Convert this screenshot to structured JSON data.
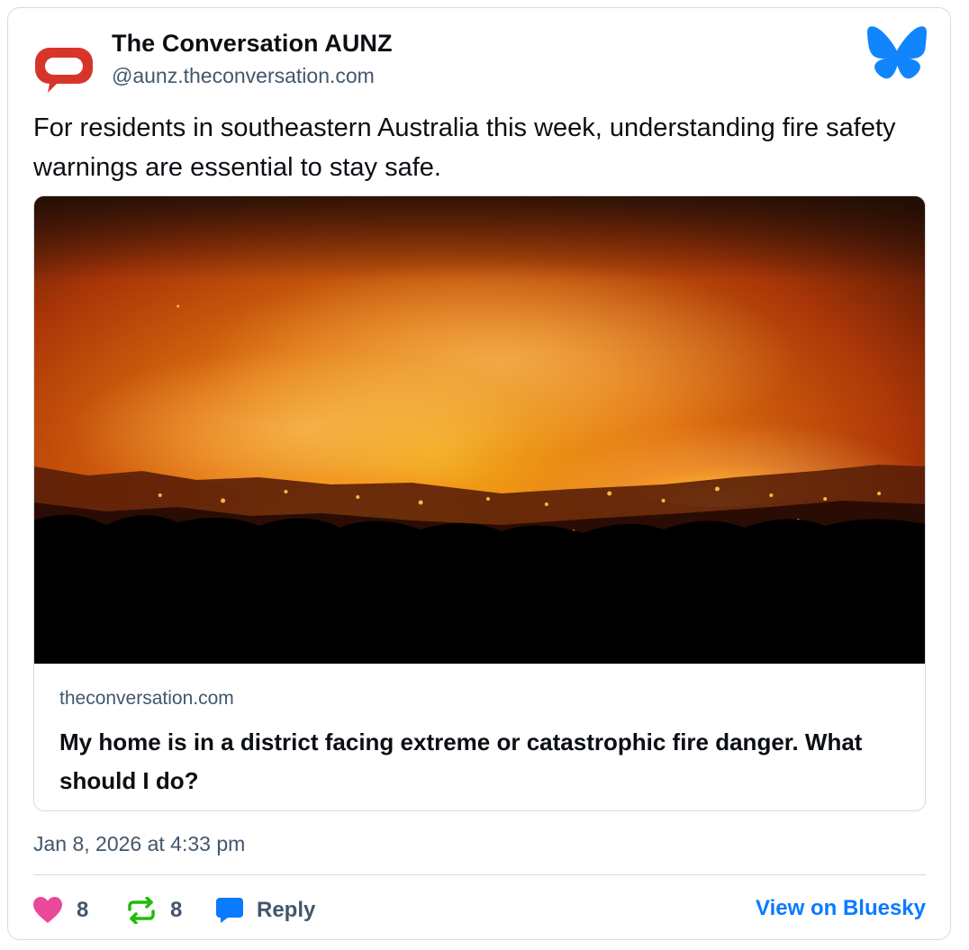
{
  "post": {
    "author": {
      "name": "The Conversation AUNZ",
      "handle": "@aunz.theconversation.com",
      "avatar_icon": "speech-bubble-logo",
      "avatar_color": "#d8352a"
    },
    "platform_icon": "butterfly-icon",
    "platform_color": "#1185fe",
    "text": "For residents in southeastern Australia this week, understanding fire safety warnings are essential to stay safe.",
    "embed": {
      "image": "bushfire-at-night",
      "domain": "theconversation.com",
      "title": "My home is in a district facing extreme or catastrophic fire danger. What should I do?"
    },
    "timestamp": "Jan 8, 2026 at 4:33 pm",
    "actions": {
      "likes": "8",
      "reposts": "8",
      "reply_label": "Reply",
      "view_label": "View on Bluesky"
    },
    "colors": {
      "like": "#ec4899",
      "repost": "#20bc07",
      "reply": "#0a7aff",
      "link": "#0a7aff",
      "muted": "#42576c"
    }
  }
}
